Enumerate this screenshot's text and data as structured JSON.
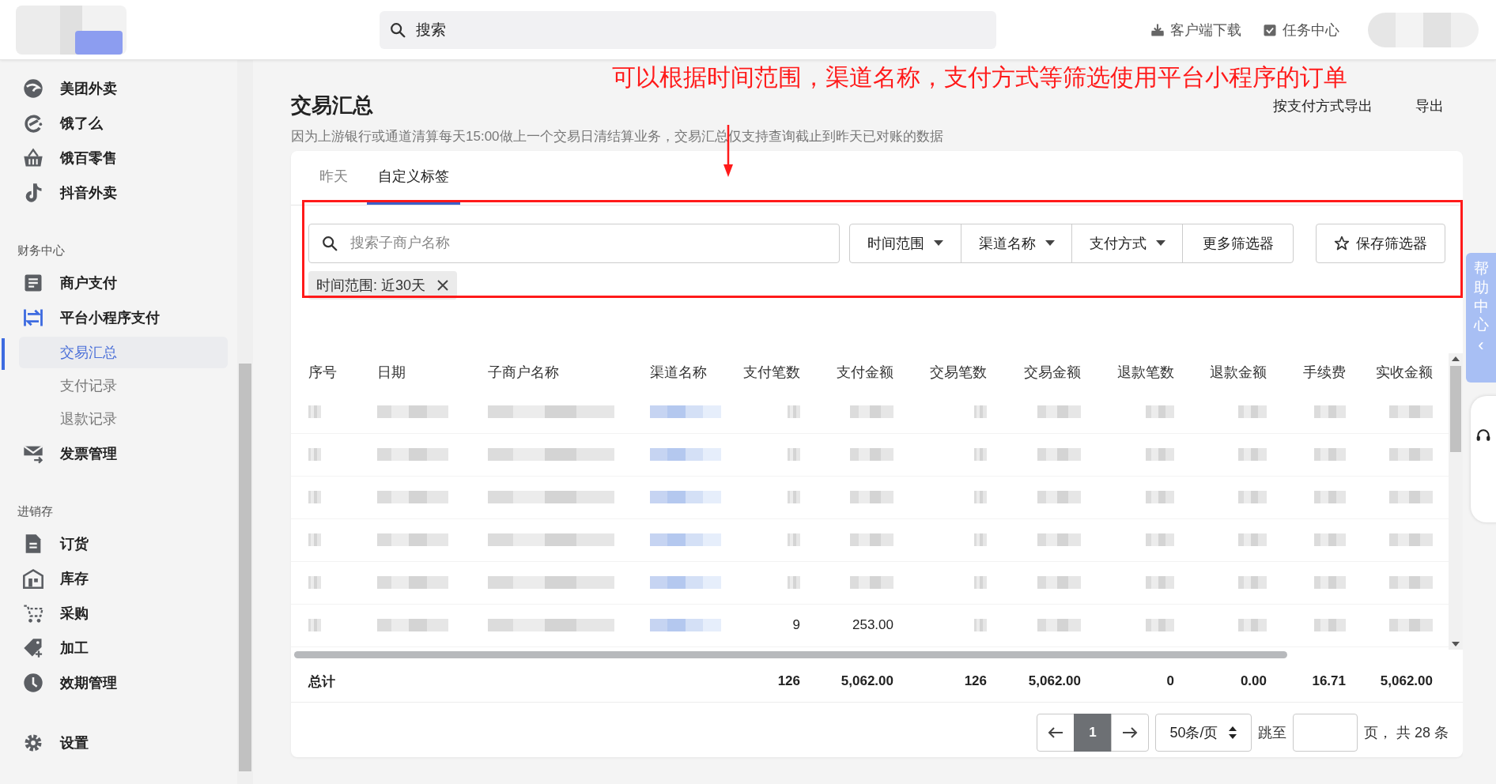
{
  "topbar": {
    "search": {
      "placeholder": "搜索"
    },
    "links": [
      {
        "label": "客户端下载"
      },
      {
        "label": "任务中心"
      }
    ]
  },
  "sidebar": {
    "groups": [
      {
        "items": [
          {
            "label": "美团外卖"
          },
          {
            "label": "饿了么"
          },
          {
            "label": "饿百零售"
          },
          {
            "label": "抖音外卖"
          }
        ]
      },
      {
        "heading": "财务中心",
        "items": [
          {
            "label": "商户支付"
          },
          {
            "label": "平台小程序支付",
            "children": [
              {
                "label": "交易汇总",
                "selected": true
              },
              {
                "label": "支付记录",
                "selected": false
              },
              {
                "label": "退款记录",
                "selected": false
              }
            ]
          },
          {
            "label": "发票管理"
          }
        ]
      },
      {
        "heading": "进销存",
        "items": [
          {
            "label": "订货"
          },
          {
            "label": "库存"
          },
          {
            "label": "采购"
          },
          {
            "label": "加工"
          },
          {
            "label": "效期管理"
          }
        ]
      },
      {
        "items": [
          {
            "label": "设置"
          }
        ]
      }
    ]
  },
  "page": {
    "title": "交易汇总",
    "subtitle": "因为上游银行或通道清算每天15:00做上一个交易日清结算业务，交易汇总仅支持查询截止到昨天已对账的数据",
    "actions": [
      {
        "label": "按支付方式导出"
      },
      {
        "label": "导出"
      }
    ]
  },
  "annotation": {
    "text": "可以根据时间范围，渠道名称，支付方式等筛选使用平台小程序的订单"
  },
  "tabs": [
    {
      "label": "昨天",
      "selected": false
    },
    {
      "label": "自定义标签",
      "selected": true
    }
  ],
  "filters": {
    "search": {
      "placeholder": "搜索子商户名称"
    },
    "dropdowns": [
      {
        "label": "时间范围",
        "kind": "dropdown"
      },
      {
        "label": "渠道名称",
        "kind": "dropdown"
      },
      {
        "label": "支付方式",
        "kind": "dropdown"
      },
      {
        "label": "更多筛选器",
        "kind": "plain"
      }
    ],
    "save_button": "保存筛选器",
    "chips": [
      {
        "label": "时间范围: 近30天"
      }
    ]
  },
  "table": {
    "columns": [
      "序号",
      "日期",
      "子商户名称",
      "渠道名称",
      "支付笔数",
      "支付金额",
      "交易笔数",
      "交易金额",
      "退款笔数",
      "退款金额",
      "手续费",
      "实收金额"
    ],
    "rows": [
      {
        "kind": "blurred"
      },
      {
        "kind": "blurred"
      },
      {
        "kind": "blurred"
      },
      {
        "kind": "blurred"
      },
      {
        "kind": "blurred"
      },
      {
        "kind": "blurred",
        "cells": {
          "4": "9",
          "5": "253.00"
        }
      }
    ],
    "totals": {
      "label": "总计",
      "values": [
        "126",
        "5,062.00",
        "126",
        "5,062.00",
        "0",
        "0.00",
        "16.71",
        "5,062.00"
      ]
    }
  },
  "pagination": {
    "pages": [
      {
        "label": "1",
        "selected": true
      }
    ],
    "page_size": "50条/页",
    "jump_label": "跳至",
    "total": "页， 共 28 条"
  },
  "help_tab": {
    "label": "帮助中心",
    "chevron": "‹"
  }
}
